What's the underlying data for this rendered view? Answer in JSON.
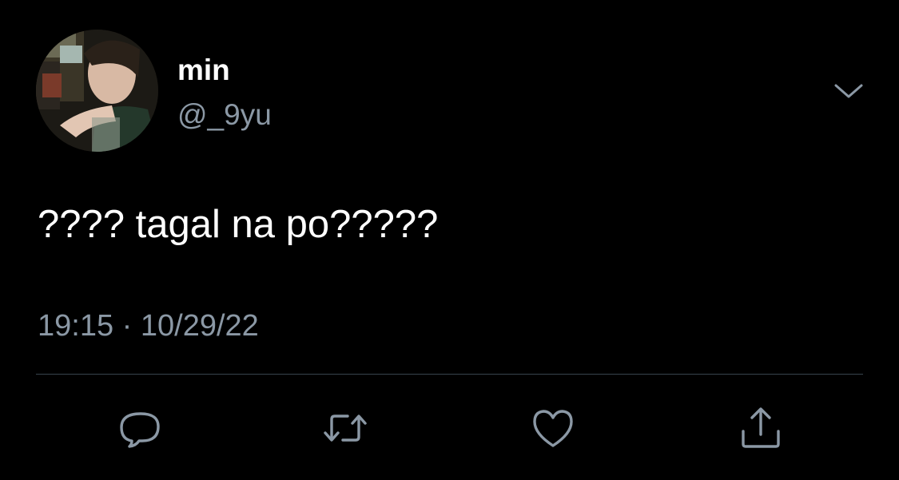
{
  "tweet": {
    "author": {
      "display_name": "min",
      "handle": "@_9yu",
      "avatar_icon": "profile-photo"
    },
    "text": "???? tagal na po?????",
    "time": "19:15",
    "separator": "·",
    "date": "10/29/22"
  },
  "actions": [
    {
      "name": "reply",
      "icon": "speech-bubble-icon"
    },
    {
      "name": "retweet",
      "icon": "retweet-arrows-icon"
    },
    {
      "name": "like",
      "icon": "heart-icon"
    },
    {
      "name": "share",
      "icon": "share-upload-icon"
    }
  ],
  "colors": {
    "background": "#000000",
    "primary_text": "#ffffff",
    "secondary_text": "#8b98a5",
    "divider": "#38444d",
    "icon": "#8b98a5"
  }
}
